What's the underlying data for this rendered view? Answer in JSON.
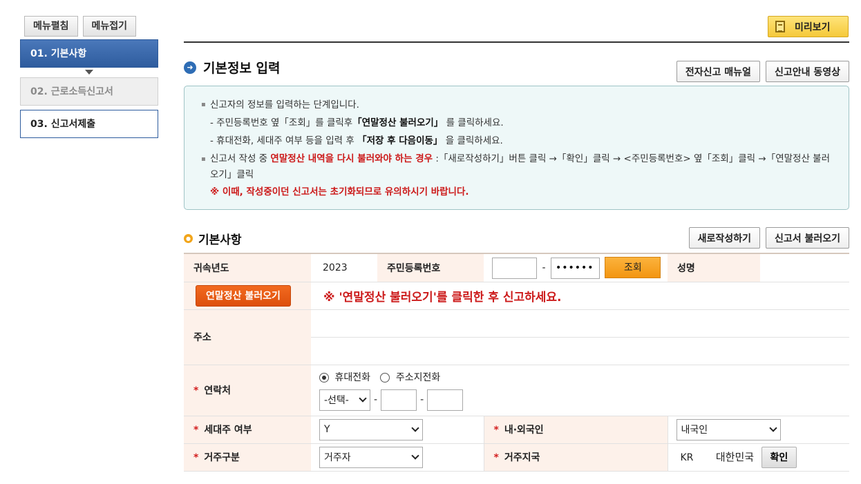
{
  "menu": {
    "expand_label": "메뉴펼침",
    "collapse_label": "메뉴접기"
  },
  "steps": [
    {
      "num": "01.",
      "label": "기본사항"
    },
    {
      "num": "02.",
      "label": "근로소득신고서"
    },
    {
      "num": "03.",
      "label": "신고서제출"
    }
  ],
  "preview_label": "미리보기",
  "page_title": "기본정보 입력",
  "top_buttons": {
    "manual": "전자신고 매뉴얼",
    "video": "신고안내 동영상"
  },
  "guide": {
    "line1": "신고자의 정보를 입력하는 단계입니다.",
    "line2_a": "- 주민등록번호 옆「조회」를 클릭후",
    "line2_b": "「연말정산 불러오기」",
    "line2_c": "를 클릭하세요.",
    "line3_a": "- 휴대전화, 세대주 여부 등을 입력 후",
    "line3_b": "「저장 후 다음이동」",
    "line3_c": "을 클릭하세요.",
    "line4_a": "신고서 작성 중",
    "line4_b": "연말정산 내역을 다시 불러와야 하는 경우",
    "line4_c": ":「새로작성하기」버튼 클릭 →「확인」클릭 → <주민등록번호> 옆「조회」클릭 →「연말정산 불러오기」클릭",
    "warning": "※ 이때, 작성중이던 신고서는 초기화되므로 유의하시기 바랍니다."
  },
  "section": {
    "title": "기본사항",
    "new_button": "새로작성하기",
    "load_button": "신고서 불러오기"
  },
  "form": {
    "year_label": "귀속년도",
    "year_value": "2023",
    "rrn_label": "주민등록번호",
    "rrn_front": "",
    "rrn_dash": "-",
    "rrn_back": "•••••••",
    "lookup_button": "조회",
    "name_label": "성명",
    "name_value": "",
    "yearend_button": "연말정산 불러오기",
    "yearend_notice": "※ '연말정산 불러오기'를 클릭한 후 신고하세요.",
    "address_label": "주소",
    "contact_label": "연락처",
    "radio_mobile": "휴대전화",
    "radio_home": "주소지전화",
    "phone_select": "-선택-",
    "phone_dash": "-",
    "householder_label": "세대주 여부",
    "householder_value": "Y",
    "nationality_label": "내·외국인",
    "nationality_value": "내국인",
    "residence_label": "거주구분",
    "residence_value": "거주자",
    "country_label": "거주지국",
    "country_code": "KR",
    "country_name": "대한민국",
    "confirm_button": "확인",
    "required_mark": "*"
  }
}
